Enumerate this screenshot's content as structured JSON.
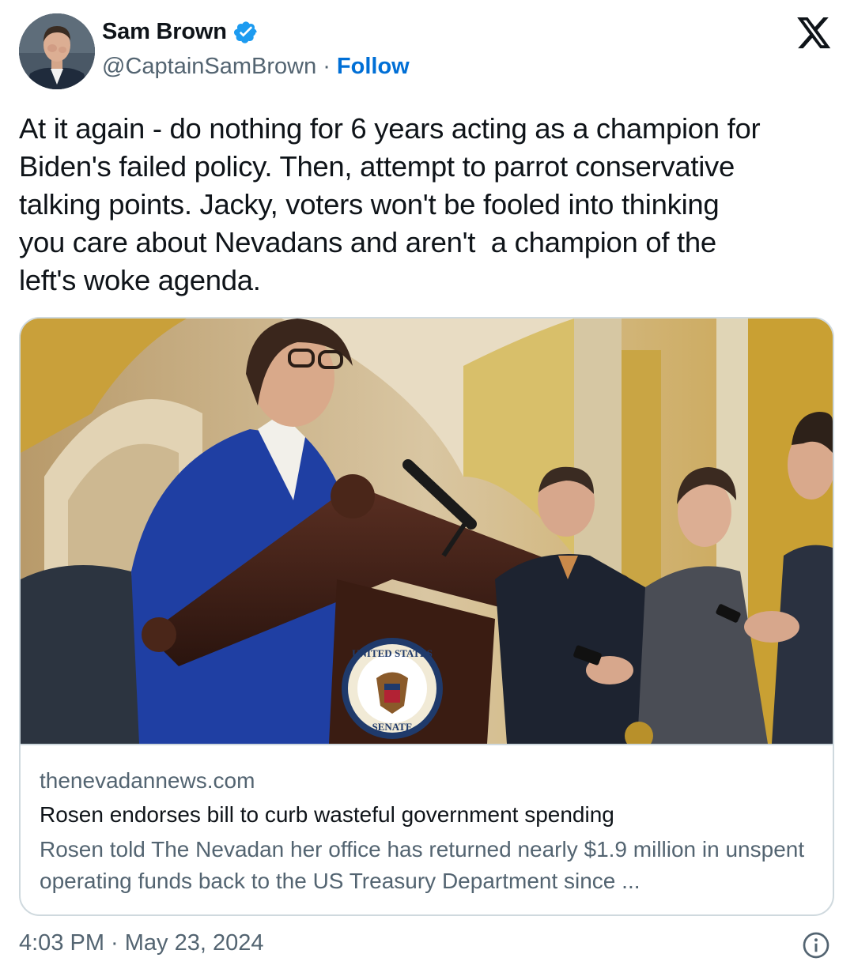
{
  "author": {
    "display_name": "Sam Brown",
    "handle": "@CaptainSamBrown",
    "separator": "·",
    "follow_label": "Follow",
    "verified_icon": "verified-badge-icon",
    "verified_color": "#1d9bf0"
  },
  "platform_icon": "x-logo-icon",
  "tweet": {
    "text": "At it again - do nothing for 6 years acting as a champion for\nBiden's failed policy. Then, attempt to parrot conservative\ntalking points. Jacky, voters won't be fooled into thinking\nyou care about Nevadans and aren't  a champion of the\nleft's woke agenda."
  },
  "card": {
    "seal_top": "UNITED STATES",
    "seal_bottom": "SENATE",
    "domain": "thenevadannews.com",
    "title": "Rosen endorses bill to curb wasteful government spending",
    "description": "Rosen told The Nevadan her office has returned nearly $1.9 million in unspent operating funds back to the US Treasury Department since ..."
  },
  "footer": {
    "timestamp": "4:03 PM · May 23, 2024",
    "info_icon": "info-icon"
  },
  "colors": {
    "link": "#006fd6",
    "secondary_text": "#536471",
    "border": "#cfd9de"
  }
}
